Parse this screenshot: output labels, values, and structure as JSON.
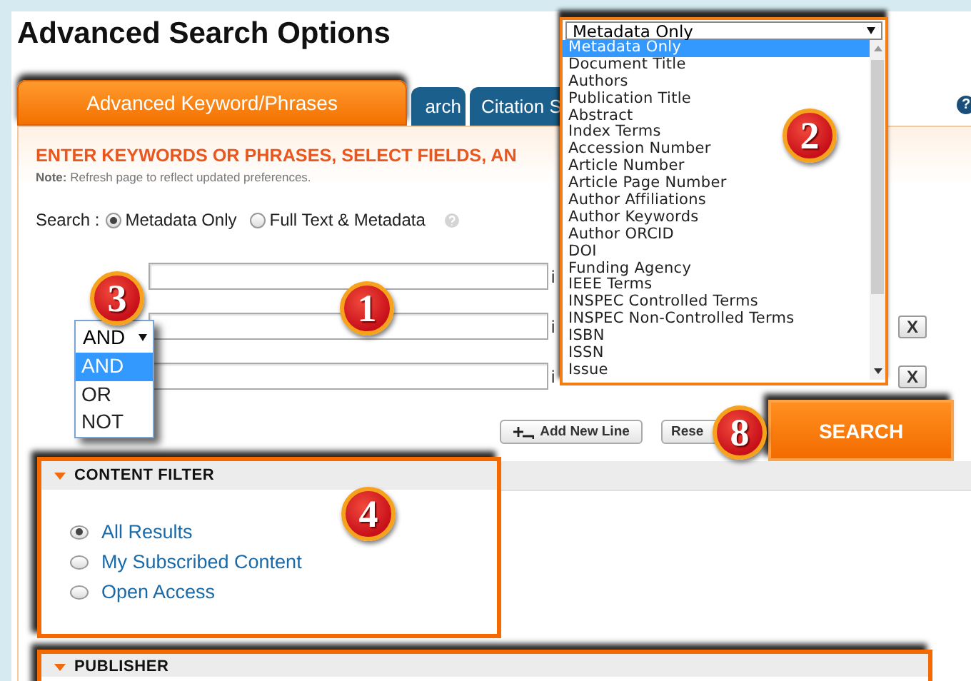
{
  "page_title": "Advanced Search Options",
  "tabs": [
    {
      "label": "Advanced Keyword/Phrases",
      "selected": true
    },
    {
      "label": "arch",
      "selected": false
    },
    {
      "label": "Citation S",
      "selected": false
    }
  ],
  "help": "?",
  "heading": "ENTER KEYWORDS OR PHRASES, SELECT FIELDS, AN",
  "note": "**Note:** Refresh page to reflect updated preferences.",
  "search_scope": {
    "label": "Search :",
    "options": [
      {
        "label": "Metadata Only",
        "selected": true
      },
      {
        "label": "Full Text & Metadata",
        "selected": false
      }
    ]
  },
  "search_rows": [
    {
      "field_cut": "i"
    },
    {
      "field_cut": "i",
      "remove": "X"
    },
    {
      "field_cut": "i",
      "remove": "X"
    }
  ],
  "field_dropdown": {
    "value": "Metadata Only",
    "options": [
      {
        "label": "Metadata Only",
        "selected": true
      },
      {
        "label": "Document Title",
        "selected": false
      },
      {
        "label": "Authors",
        "selected": false
      },
      {
        "label": "Publication Title",
        "selected": false
      },
      {
        "label": "Abstract",
        "selected": false
      },
      {
        "label": "Index Terms",
        "selected": false
      },
      {
        "label": "Accession Number",
        "selected": false
      },
      {
        "label": "Article Number",
        "selected": false
      },
      {
        "label": "Article Page Number",
        "selected": false
      },
      {
        "label": "Author Affiliations",
        "selected": false
      },
      {
        "label": "Author Keywords",
        "selected": false
      },
      {
        "label": "Author ORCID",
        "selected": false
      },
      {
        "label": "DOI",
        "selected": false
      },
      {
        "label": "Funding Agency",
        "selected": false
      },
      {
        "label": "IEEE Terms",
        "selected": false
      },
      {
        "label": "INSPEC Controlled Terms",
        "selected": false
      },
      {
        "label": "INSPEC Non-Controlled Terms",
        "selected": false
      },
      {
        "label": "ISBN",
        "selected": false
      },
      {
        "label": "ISSN",
        "selected": false
      },
      {
        "label": "Issue",
        "selected": false
      }
    ]
  },
  "operator_dropdown": {
    "value": "AND",
    "options": [
      {
        "label": "AND",
        "selected": true
      },
      {
        "label": "OR",
        "selected": false
      },
      {
        "label": "NOT",
        "selected": false
      }
    ]
  },
  "buttons": {
    "add_line": "Add New Line",
    "reset": "Rese",
    "search": "SEARCH"
  },
  "content_filter": {
    "title": "CONTENT FILTER",
    "expanded": true,
    "options": [
      {
        "label": "All Results",
        "selected": true
      },
      {
        "label": "My Subscribed Content",
        "selected": false
      },
      {
        "label": "Open Access",
        "selected": false
      }
    ]
  },
  "publisher": {
    "title": "PUBLISHER",
    "expanded": true
  },
  "annotations": [
    {
      "label": "1"
    },
    {
      "label": "2"
    },
    {
      "label": "3"
    },
    {
      "label": "4"
    },
    {
      "label": "8"
    }
  ]
}
